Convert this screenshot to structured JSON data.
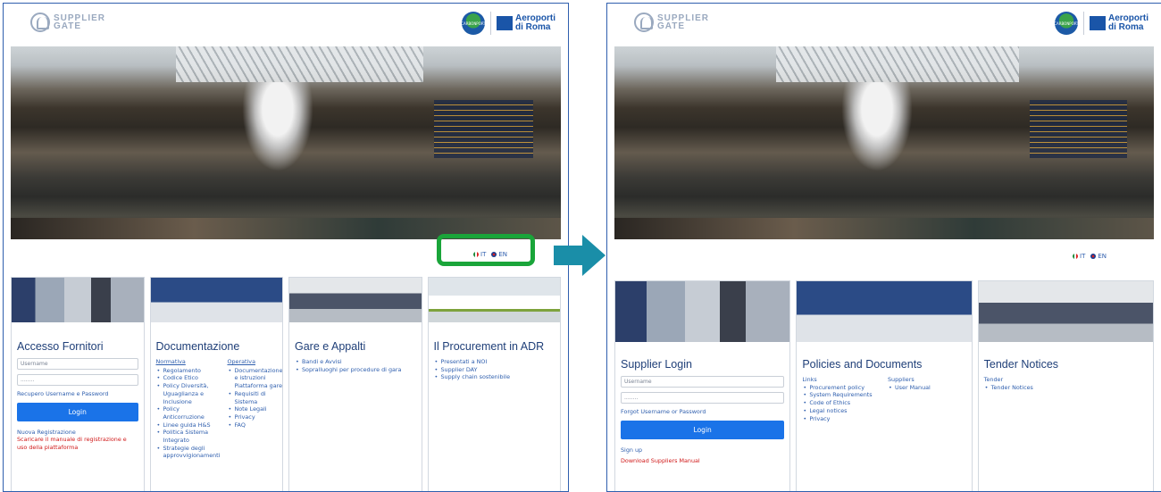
{
  "left": {
    "brand": {
      "sg_line1": "SUPPLIER",
      "sg_line2": "GATE",
      "carbon": "CARBONPORT",
      "adr1": "Aeroporti",
      "adr2": "di Roma"
    },
    "lang": {
      "it": "IT",
      "en": "EN"
    },
    "login": {
      "title": "Accesso Fornitori",
      "username_placeholder": "Username",
      "password_placeholder": "........",
      "recover": "Recupero Username e Password",
      "button": "Login",
      "register": "Nuova Registrazione",
      "manual": "Scaricare il manuale di registrazione e uso della piattaforma"
    },
    "docs": {
      "title": "Documentazione",
      "col1_head": "Normativa",
      "col1": [
        "Regolamento",
        "Codice Etico",
        "Policy Diversità, Uguaglianza e Inclusione",
        "Policy Anticorruzione",
        "Linee guida H&S",
        "Politica Sistema Integrato",
        "Strategie degli approvvigionamenti"
      ],
      "col2_head": "Operativa",
      "col2": [
        "Documentazione e istruzioni Piattaforma gare",
        "Requisiti di Sistema",
        "Note Legali",
        "Privacy",
        "FAQ"
      ]
    },
    "tenders": {
      "title": "Gare e Appalti",
      "items": [
        "Bandi e Avvisi",
        "Sopralluoghi per procedure di gara"
      ]
    },
    "procurement": {
      "title": "Il Procurement in ADR",
      "items": [
        "Presentati a NOI",
        "Supplier DAY",
        "Supply chain sostenibile"
      ]
    }
  },
  "right": {
    "brand": {
      "sg_line1": "SUPPLIER",
      "sg_line2": "GATE",
      "carbon": "CARBONPORT",
      "adr1": "Aeroporti",
      "adr2": "di Roma"
    },
    "lang": {
      "it": "IT",
      "en": "EN"
    },
    "login": {
      "title": "Supplier Login",
      "username_placeholder": "Username",
      "password_placeholder": "........",
      "recover": "Forgot Username or Password",
      "button": "Login",
      "register": "Sign up",
      "manual": "Download Suppliers Manual"
    },
    "docs": {
      "title": "Policies and Documents",
      "col1_head": "Links",
      "col1": [
        "Procurement policy",
        "System Requirements",
        "Code of Ethics",
        "Legal notices",
        "Privacy"
      ],
      "col2_head": "Suppliers",
      "col2": [
        "User Manual"
      ]
    },
    "tenders": {
      "title": "Tender Notices",
      "head": "Tender",
      "items": [
        "Tender Notices"
      ]
    }
  },
  "colors": {
    "highlight": "#1aa53a",
    "arrow": "#1a8ea8",
    "accent": "#1a73e8",
    "title": "#1f3f78"
  }
}
